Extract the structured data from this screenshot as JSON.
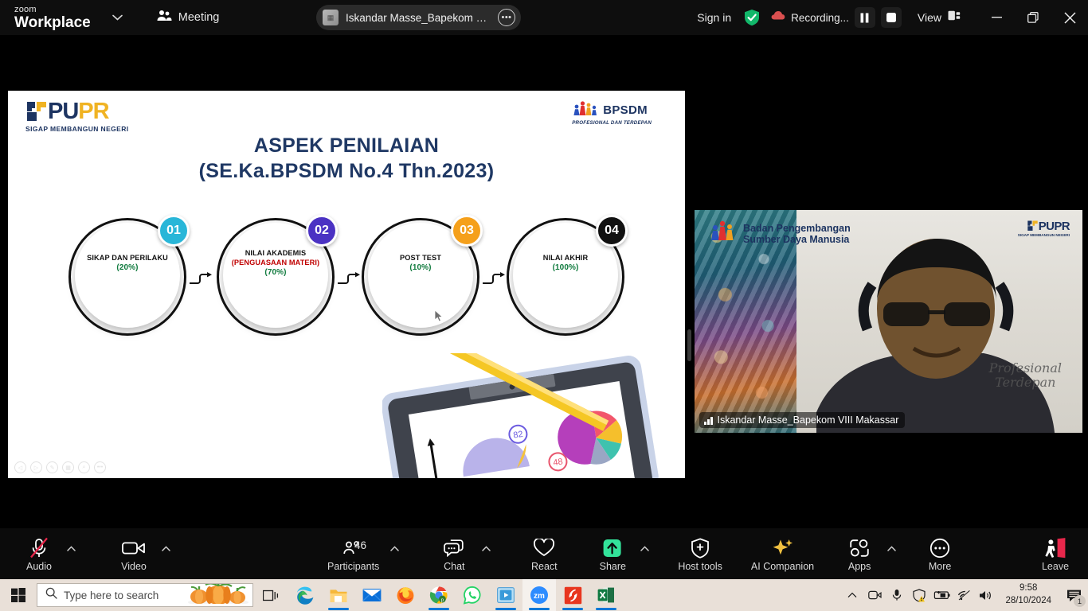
{
  "titlebar": {
    "brand_top": "zoom",
    "brand_bottom": "Workplace",
    "brand_caret_icon": "chevron-down-icon",
    "meeting_label": "Meeting",
    "meeting_icon": "people-icon",
    "file_tab": {
      "name": "Iskandar Masse_Bapekom VIII Ma",
      "thumb_icon": "document-thumbnail-icon",
      "more_icon": "ellipsis-icon"
    },
    "sign_in": "Sign in",
    "encryption_icon": "shield-check-icon",
    "recording": {
      "label": "Recording...",
      "icon": "recording-cloud-icon",
      "pause_icon": "pause-icon",
      "stop_icon": "stop-icon"
    },
    "view": {
      "label": "View",
      "icon": "layout-view-icon"
    },
    "window": {
      "minimize_icon": "minimize-icon",
      "maximize_icon": "restore-icon",
      "close_icon": "close-icon"
    }
  },
  "slide": {
    "pupr_logo": {
      "word_pu": "PU",
      "word_pr": "PR",
      "tagline": "SIGAP MEMBANGUN NEGERI"
    },
    "bpsdm_logo": {
      "word": "BPSDM",
      "tagline": "PROFESIONAL DAN TERDEPAN"
    },
    "title_line1": "ASPEK PENILAIAN",
    "title_line2": "(SE.Ka.BPSDM No.4 Thn.2023)",
    "steps": [
      {
        "badge": "01",
        "badge_color": "#29b6d8",
        "name": "SIKAP DAN PERILAKU",
        "sub": "",
        "weight": "(20%)"
      },
      {
        "badge": "02",
        "badge_color": "#4b32c3",
        "name": "NILAI AKADEMIS",
        "sub": "(PENGUASAAN MATERI)",
        "weight": "(70%)"
      },
      {
        "badge": "03",
        "badge_color": "#f5a01b",
        "name": "POST TEST",
        "sub": "",
        "weight": "(10%)"
      },
      {
        "badge": "04",
        "badge_color": "#111111",
        "name": "NILAI AKHIR",
        "sub": "",
        "weight": "(100%)"
      }
    ],
    "artwork_icon": "tablet-with-pencil-and-charts-illustration",
    "chart_labels": {
      "gauge": "82",
      "circle": "48"
    },
    "ppt_controls": [
      "prev-slide-icon",
      "next-slide-icon",
      "pen-icon",
      "all-slides-icon",
      "zoom-icon",
      "more-options-icon"
    ],
    "resize_grip_icon": "drag-handle-icon"
  },
  "video_tile": {
    "org_line1": "Badan Pengembangan",
    "org_line2": "Sumber Daya Manusia",
    "org_logo_icon": "bpsdm-people-icon",
    "corner_logo": {
      "word": "PUPR",
      "tagline": "SIGAP MEMBANGUN NEGERI"
    },
    "backdrop_text_line1": "Profesional",
    "backdrop_text_line2": "Terdepan",
    "participant_name": "Iskandar Masse_Bapekom VIII Makassar",
    "audio_level_icon": "audio-bars-icon"
  },
  "toolbar": {
    "items": [
      {
        "label": "Audio",
        "icon": "microphone-muted-icon",
        "caret": true,
        "badge": ""
      },
      {
        "label": "Video",
        "icon": "camera-icon",
        "caret": true,
        "badge": ""
      },
      {
        "label": "Participants",
        "icon": "participants-icon",
        "caret": true,
        "badge": "46"
      },
      {
        "label": "Chat",
        "icon": "chat-bubble-icon",
        "caret": true,
        "badge": ""
      },
      {
        "label": "React",
        "icon": "heart-icon",
        "caret": false,
        "badge": ""
      },
      {
        "label": "Share",
        "icon": "share-screen-icon",
        "caret": true,
        "badge": ""
      },
      {
        "label": "Host tools",
        "icon": "shield-host-icon",
        "caret": false,
        "badge": ""
      },
      {
        "label": "AI Companion",
        "icon": "sparkle-ai-icon",
        "caret": false,
        "badge": ""
      },
      {
        "label": "Apps",
        "icon": "apps-icon",
        "caret": true,
        "badge": ""
      },
      {
        "label": "More",
        "icon": "more-ellipsis-icon",
        "caret": false,
        "badge": ""
      }
    ],
    "leave": {
      "label": "Leave",
      "icon": "leave-door-icon"
    },
    "share_accent": "#33e39a",
    "ai_accent": "#f0c040",
    "leave_accent": "#e8274b",
    "mute_accent": "#e8274b"
  },
  "taskbar": {
    "start_icon": "windows-start-icon",
    "search": {
      "placeholder": "Type here to search",
      "icon": "search-icon",
      "art_icon": "pumpkins-icon"
    },
    "task_view_icon": "task-view-icon",
    "apps": [
      {
        "name": "edge-icon",
        "running": false,
        "active": false
      },
      {
        "name": "file-explorer-icon",
        "running": true,
        "active": false
      },
      {
        "name": "mail-icon",
        "running": false,
        "active": false
      },
      {
        "name": "firefox-icon",
        "running": false,
        "active": false
      },
      {
        "name": "chrome-icon",
        "running": true,
        "active": false
      },
      {
        "name": "whatsapp-icon",
        "running": false,
        "active": false
      },
      {
        "name": "media-player-icon",
        "running": true,
        "active": false
      },
      {
        "name": "zoom-icon",
        "running": true,
        "active": true
      },
      {
        "name": "smadav-icon",
        "running": true,
        "active": false
      },
      {
        "name": "excel-icon",
        "running": true,
        "active": false
      }
    ],
    "tray": [
      "show-hidden-icons-icon",
      "zoom-tray-icon",
      "microphone-tray-icon",
      "security-warning-icon",
      "battery-charging-icon",
      "wifi-icon",
      "volume-icon"
    ],
    "clock": {
      "time": "9:58",
      "date": "28/10/2024"
    },
    "notification": {
      "icon": "notification-icon",
      "count": "1"
    }
  }
}
